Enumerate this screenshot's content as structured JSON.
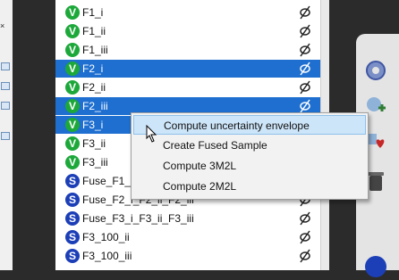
{
  "tree_items": [
    {
      "label": "F1_i",
      "icon": "V",
      "selected": false
    },
    {
      "label": "F1_ii",
      "icon": "V",
      "selected": false
    },
    {
      "label": "F1_iii",
      "icon": "V",
      "selected": false
    },
    {
      "label": "F2_i",
      "icon": "V",
      "selected": true
    },
    {
      "label": "F2_ii",
      "icon": "V",
      "selected": false
    },
    {
      "label": "F2_iii",
      "icon": "V",
      "selected": true
    },
    {
      "label": "F3_i",
      "icon": "V",
      "selected": true
    },
    {
      "label": "F3_ii",
      "icon": "V",
      "selected": false
    },
    {
      "label": "F3_iii",
      "icon": "V",
      "selected": false
    },
    {
      "label": "Fuse_F1_i_F1_ii_F1_iii",
      "icon": "S",
      "selected": false
    },
    {
      "label": "Fuse_F2_i_F2_ii_F2_iii",
      "icon": "S",
      "selected": false
    },
    {
      "label": "Fuse_F3_i_F3_ii_F3_iii",
      "icon": "S",
      "selected": false
    },
    {
      "label": "F3_100_ii",
      "icon": "S",
      "selected": false
    },
    {
      "label": "F3_100_iii",
      "icon": "S",
      "selected": false
    }
  ],
  "context_menu": {
    "items": [
      {
        "label": "Compute uncertainty envelope",
        "highlighted": true
      },
      {
        "label": "Create Fused Sample",
        "highlighted": false
      },
      {
        "label": "Compute 3M2L",
        "highlighted": false
      },
      {
        "label": "Compute 2M2L",
        "highlighted": false
      }
    ]
  },
  "colors": {
    "selection": "#1e6fd0",
    "menu_highlight": "#cde5f9",
    "v_icon": "#1da83a",
    "s_icon": "#1c3fb8"
  },
  "icons": [
    "v-icon",
    "s-icon",
    "visibility-toggle-icon",
    "gear-icon",
    "plus-icon",
    "heart-icon",
    "trash-icon"
  ]
}
